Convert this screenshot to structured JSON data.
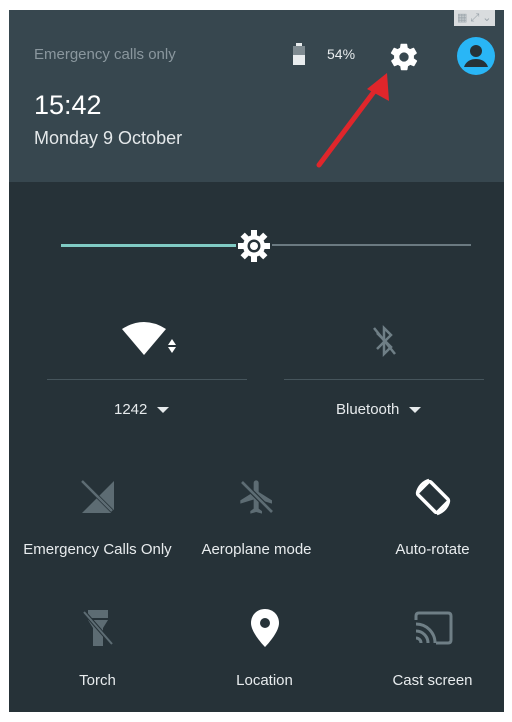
{
  "status_bar": {
    "carrier_text": "Emergency calls only",
    "battery_percent": "54%",
    "battery_level": 0.54
  },
  "header": {
    "time": "15:42",
    "date": "Monday 9 October"
  },
  "brightness": {
    "level": 0.47
  },
  "big_tiles": {
    "wifi": {
      "label": "1242",
      "icon": "wifi-icon"
    },
    "bluetooth": {
      "label": "Bluetooth",
      "icon": "bluetooth-off-icon"
    }
  },
  "tiles": [
    {
      "label": "Emergency Calls Only",
      "icon": "no-signal-icon"
    },
    {
      "label": "Aeroplane mode",
      "icon": "airplane-icon"
    },
    {
      "label": "Auto-rotate",
      "icon": "auto-rotate-icon"
    },
    {
      "label": "Torch",
      "icon": "flashlight-icon"
    },
    {
      "label": "Location",
      "icon": "location-pin-icon"
    },
    {
      "label": "Cast screen",
      "icon": "cast-icon"
    }
  ],
  "colors": {
    "panel_bg": "#263238",
    "header_bg": "#37474f",
    "accent": "#80cbc4",
    "avatar": "#29b6f6",
    "annotation_arrow": "#e0262b"
  }
}
